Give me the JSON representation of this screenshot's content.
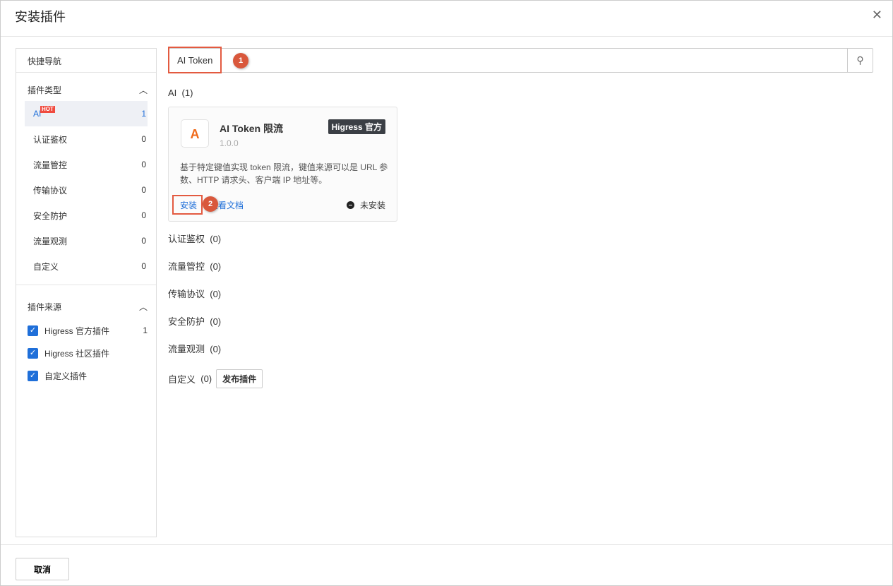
{
  "dialog": {
    "title": "安装插件",
    "cancel": "取消"
  },
  "sidebar": {
    "nav_title": "快捷导航",
    "type_title": "插件类型",
    "hot": "HOT",
    "types": [
      {
        "label": "AI",
        "count": "1"
      },
      {
        "label": "认证鉴权",
        "count": "0"
      },
      {
        "label": "流量管控",
        "count": "0"
      },
      {
        "label": "传输协议",
        "count": "0"
      },
      {
        "label": "安全防护",
        "count": "0"
      },
      {
        "label": "流量观测",
        "count": "0"
      },
      {
        "label": "自定义",
        "count": "0"
      }
    ],
    "source_title": "插件来源",
    "sources": [
      {
        "label": "Higress 官方插件",
        "count": "1",
        "checked": true
      },
      {
        "label": "Higress 社区插件",
        "count": "",
        "checked": true
      },
      {
        "label": "自定义插件",
        "count": "",
        "checked": true
      }
    ]
  },
  "search": {
    "value": "AI Token"
  },
  "annotations": {
    "one": "1",
    "two": "2"
  },
  "categories": [
    {
      "label": "AI",
      "count": "(1)"
    },
    {
      "label": "认证鉴权",
      "count": "(0)"
    },
    {
      "label": "流量管控",
      "count": "(0)"
    },
    {
      "label": "传输协议",
      "count": "(0)"
    },
    {
      "label": "安全防护",
      "count": "(0)"
    },
    {
      "label": "流量观测",
      "count": "(0)"
    },
    {
      "label": "自定义",
      "count": "(0)"
    }
  ],
  "publish": "发布插件",
  "card": {
    "name": "AI Token 限流",
    "version": "1.0.0",
    "tag": "Higress 官方",
    "desc": "基于特定键值实现 token 限流，键值来源可以是 URL 参数、HTTP 请求头、客户端 IP 地址等。",
    "install": "安装",
    "doc": "查看文档",
    "status": "未安装"
  }
}
